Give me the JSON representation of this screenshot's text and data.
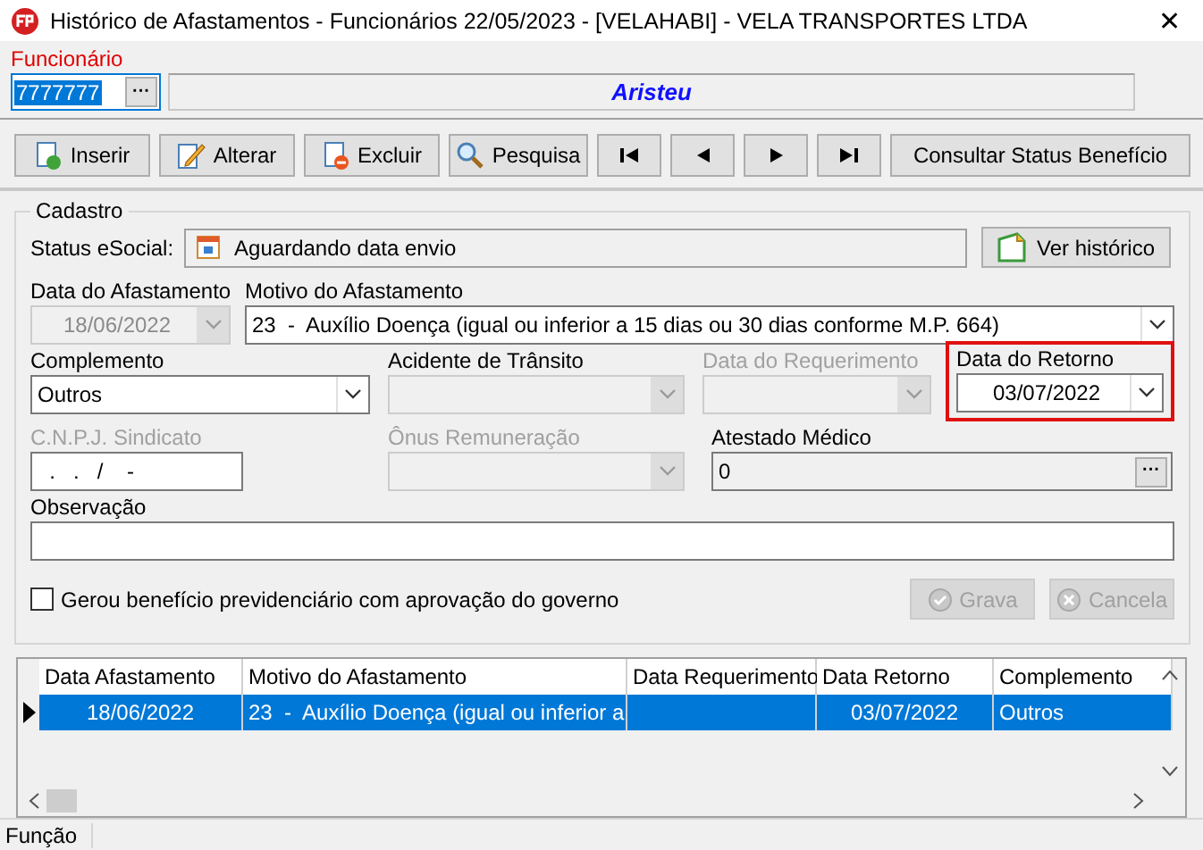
{
  "window": {
    "title": "Histórico de Afastamentos - Funcionários  22/05/2023 - [VELAHABI] - VELA TRANSPORTES LTDA",
    "close": "✕"
  },
  "employee": {
    "label": "Funcionário",
    "code": "7777777",
    "ellipsis": "···",
    "name": "Aristeu"
  },
  "toolbar": [
    {
      "kind": "insert",
      "label": "Inserir"
    },
    {
      "kind": "edit",
      "label": "Alterar"
    },
    {
      "kind": "delete",
      "label": "Excluir"
    },
    {
      "kind": "search",
      "label": "Pesquisa"
    },
    {
      "kind": "first"
    },
    {
      "kind": "prev"
    },
    {
      "kind": "next"
    },
    {
      "kind": "last"
    },
    {
      "kind": "plain",
      "label": "Consultar Status Benefício"
    }
  ],
  "cadastro": {
    "title": "Cadastro",
    "status_label": "Status eSocial:",
    "status_value": "Aguardando data envio",
    "history_button": "Ver histórico",
    "rows": [
      [
        {
          "label": "Data do Afastamento",
          "value": "18/06/2022",
          "kind": "combo",
          "disabled": true,
          "dim_label": false,
          "highlighted": false
        },
        {
          "label": "Motivo do Afastamento",
          "value": "23  -  Auxílio Doença (igual ou inferior a 15 dias ou 30 dias conforme M.P. 664)",
          "kind": "combo",
          "disabled": false,
          "dim_label": false,
          "highlighted": false
        }
      ],
      [
        {
          "label": "Complemento",
          "value": "Outros",
          "kind": "combo",
          "disabled": false,
          "dim_label": false,
          "highlighted": false
        },
        {
          "label": "Acidente de Trânsito",
          "kind": "combo",
          "disabled": true,
          "dim_label": false,
          "highlighted": false
        },
        {
          "label": "Data do Requerimento",
          "kind": "combo",
          "disabled": true,
          "dim_label": true,
          "highlighted": false
        },
        {
          "label": "Data do Retorno",
          "value": "03/07/2022",
          "kind": "combo",
          "disabled": false,
          "dim_label": false,
          "highlighted": true
        }
      ],
      [
        {
          "label": "C.N.P.J. Sindicato",
          "value": "  .   .   /    -",
          "kind": "text",
          "disabled": false,
          "dim_label": true,
          "highlighted": false
        },
        {
          "label": "Ônus Remuneração",
          "kind": "combo",
          "disabled": true,
          "dim_label": true,
          "highlighted": false
        },
        {
          "label": "Atestado Médico",
          "value": "0",
          "ellipsis": "···",
          "kind": "lookup",
          "disabled": true,
          "dim_label": false,
          "highlighted": false
        }
      ],
      [
        {
          "label": "Observação",
          "kind": "text",
          "disabled": false,
          "dim_label": false,
          "highlighted": false
        }
      ]
    ],
    "checkbox": {
      "label": "Gerou benefício previdenciário com aprovação do governo",
      "checked": false
    },
    "actions": [
      {
        "kind": "save",
        "label": "Grava",
        "disabled": true
      },
      {
        "kind": "cancel",
        "label": "Cancela",
        "disabled": true
      }
    ]
  },
  "table": {
    "columns": [
      "Data Afastamento",
      "Motivo do Afastamento",
      "Data Requerimento",
      "Data Retorno",
      "Complemento"
    ],
    "rows": [
      {
        "cells": [
          "18/06/2022",
          "23  -  Auxílio Doença (igual ou inferior a",
          "",
          "03/07/2022",
          "Outros"
        ],
        "selected": true
      }
    ]
  },
  "status_bar": "Função"
}
